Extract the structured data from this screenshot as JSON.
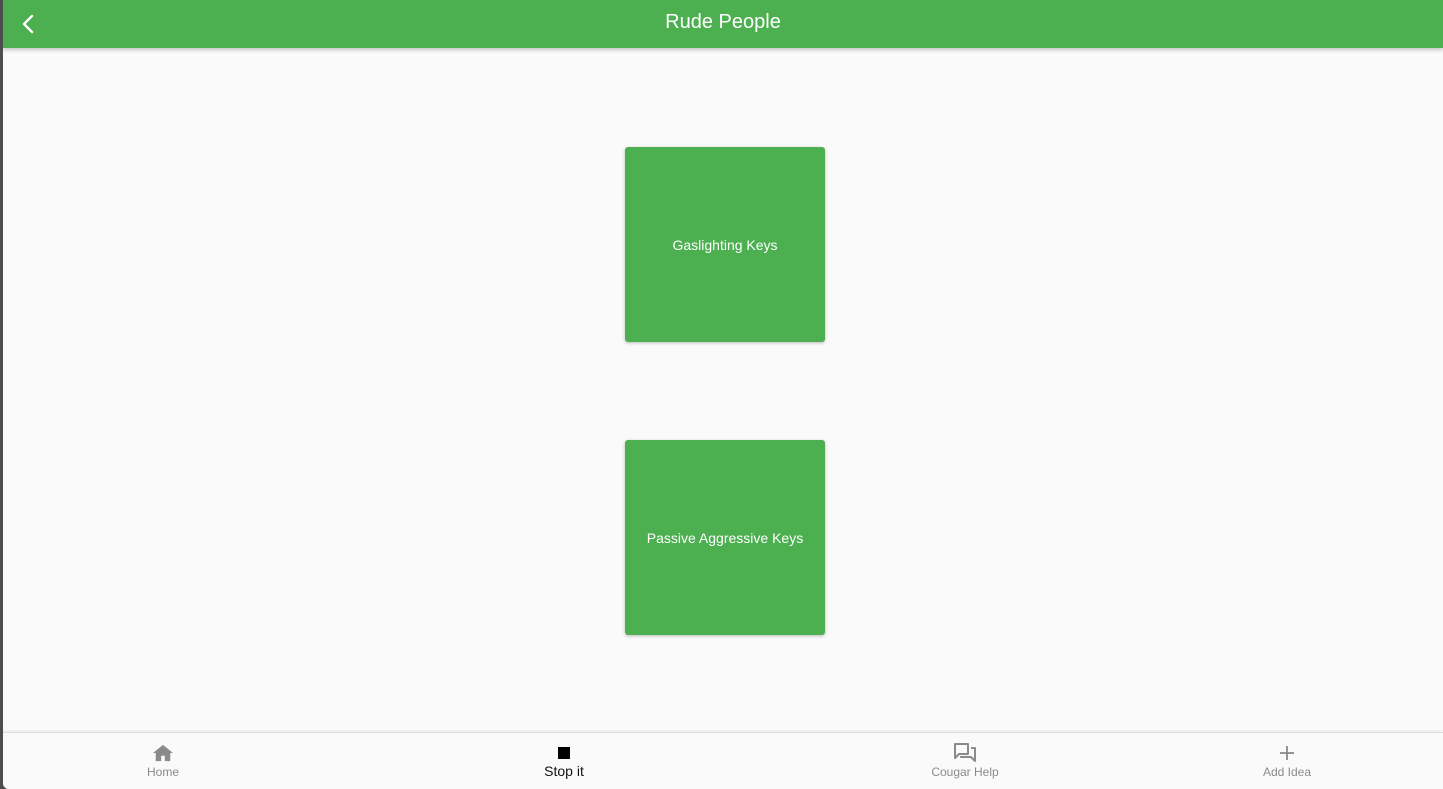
{
  "appbar": {
    "title": "Rude People",
    "back_icon": "chevron-left-icon"
  },
  "cards": [
    {
      "label": "Gaslighting Keys"
    },
    {
      "label": "Passive Aggressive Keys"
    }
  ],
  "bottom_nav": {
    "active_index": 1,
    "items": [
      {
        "label": "Home",
        "icon": "home-icon"
      },
      {
        "label": "Stop it",
        "icon": "stop-icon"
      },
      {
        "label": "Cougar Help",
        "icon": "forum-icon"
      },
      {
        "label": "Add Idea",
        "icon": "plus-icon"
      }
    ]
  },
  "colors": {
    "primary": "#4caf50",
    "background": "#fafafa",
    "nav_inactive": "#8a8a8a",
    "nav_active": "#111111"
  }
}
